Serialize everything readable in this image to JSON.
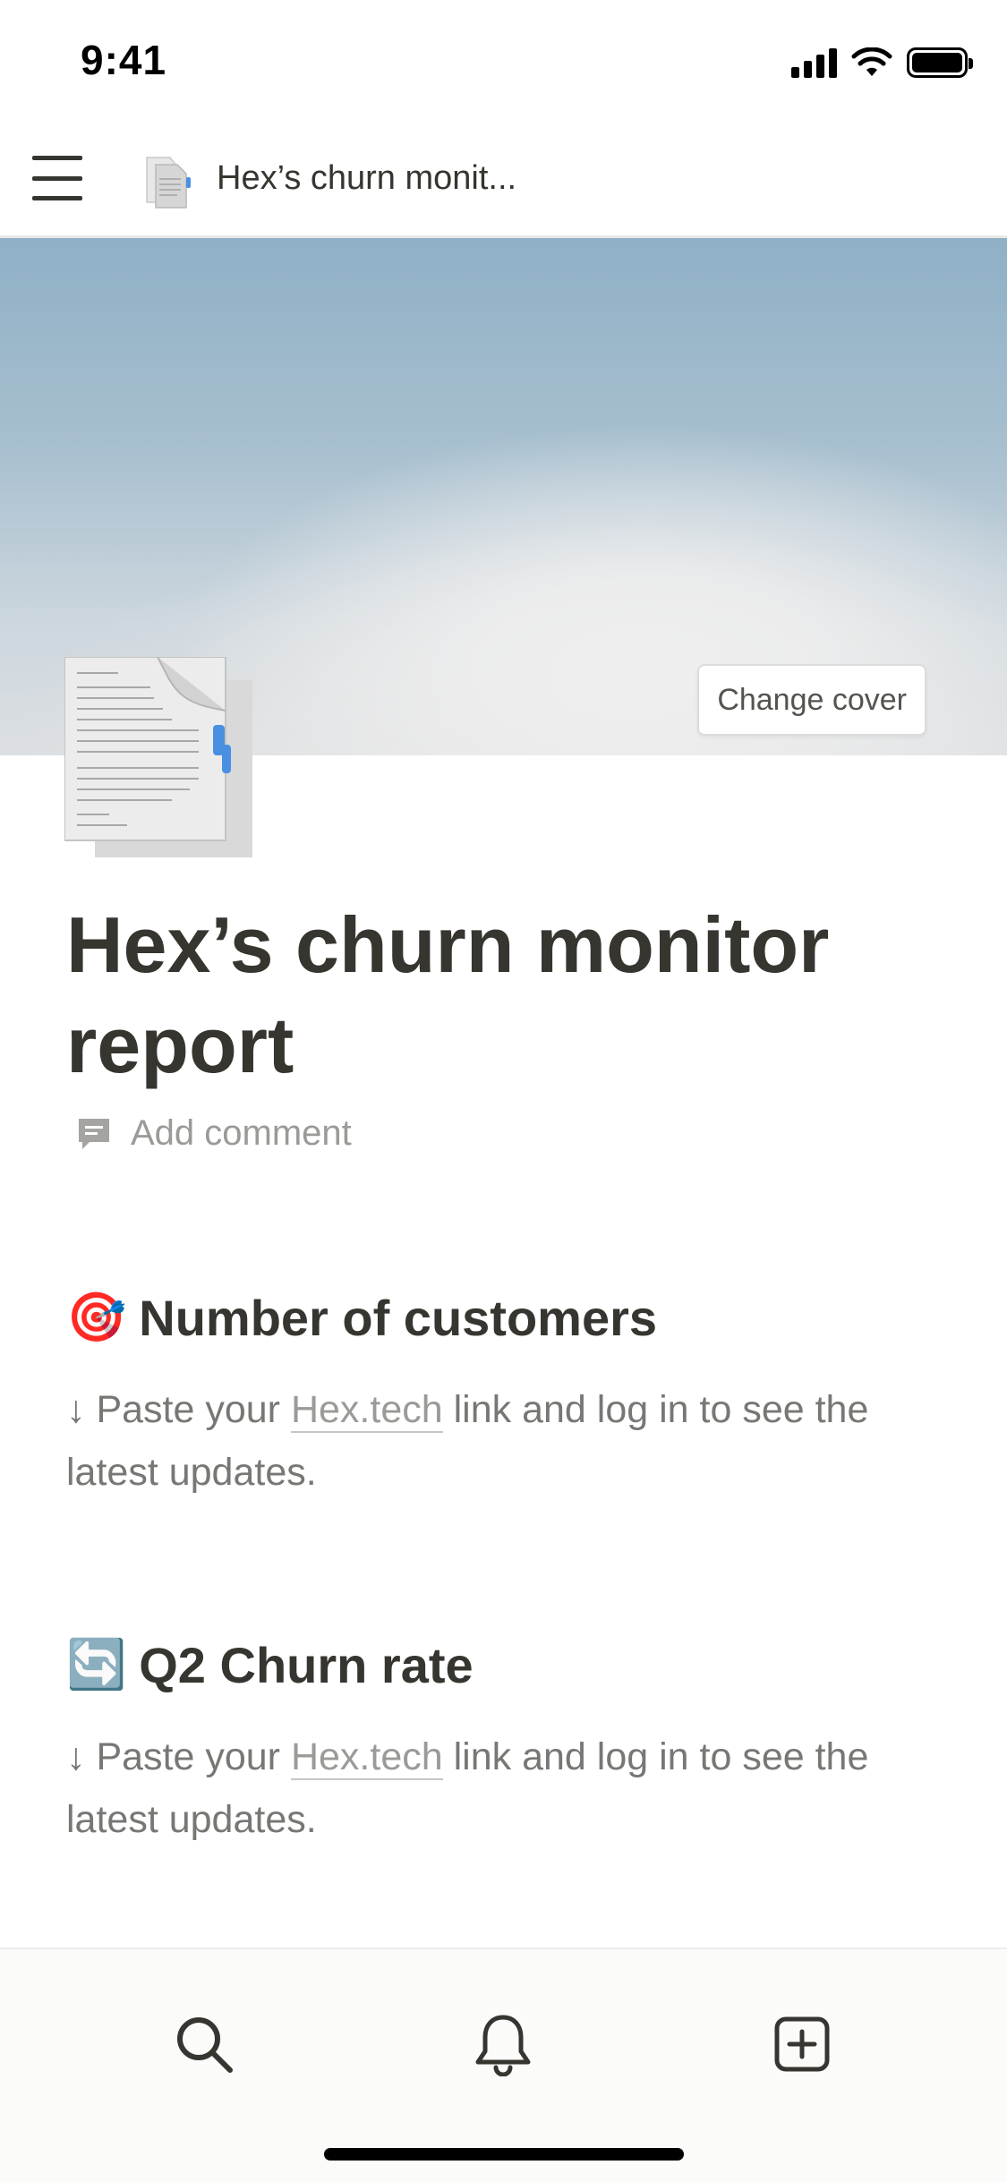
{
  "status_bar": {
    "time": "9:41"
  },
  "nav": {
    "page_title": "Hex’s churn monit..."
  },
  "cover": {
    "change_cover_label": "Change cover"
  },
  "page": {
    "title": "Hex’s churn monitor report",
    "add_comment_label": "Add comment"
  },
  "sections": [
    {
      "emoji": "🎯",
      "heading": "Number of customers",
      "text_before": "↓ Paste your ",
      "link_text": "Hex.tech",
      "text_after": " link and log in to see the latest updates."
    },
    {
      "emoji": "🔄",
      "heading": "Q2 Churn rate",
      "text_before": "↓ Paste your ",
      "link_text": "Hex.tech",
      "text_after": " link and log in to see the latest updates."
    }
  ],
  "bottom_bar": {
    "icons": [
      "search-icon",
      "bell-icon",
      "add-page-icon"
    ]
  },
  "colors": {
    "text": "#37352f",
    "muted": "#9b9a97",
    "cover_blue": "#8fb0c6"
  }
}
